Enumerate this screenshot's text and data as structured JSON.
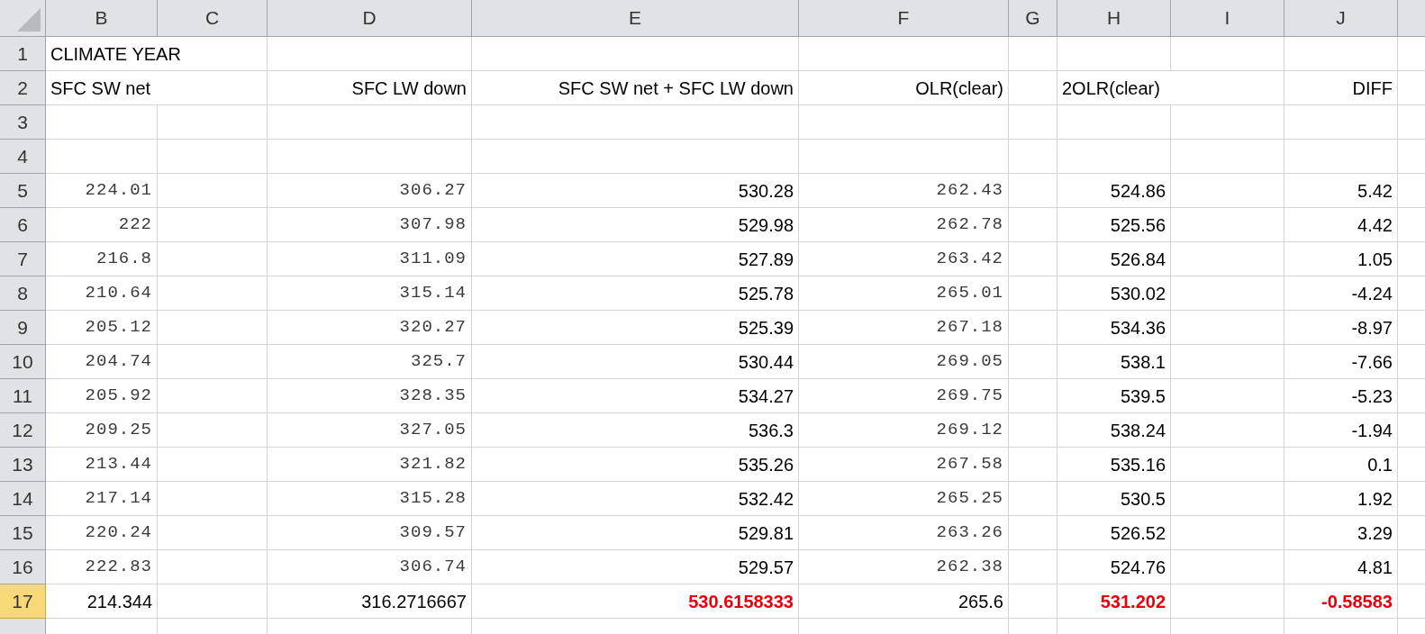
{
  "columns": [
    {
      "label": "B"
    },
    {
      "label": "C"
    },
    {
      "label": "D"
    },
    {
      "label": "E"
    },
    {
      "label": "F"
    },
    {
      "label": "G"
    },
    {
      "label": "H"
    },
    {
      "label": "I"
    },
    {
      "label": "J"
    }
  ],
  "rows": [
    {
      "number": "1",
      "selected": false,
      "cells": {
        "b": {
          "text": "CLIMATE YEAR",
          "kind": "left"
        }
      }
    },
    {
      "number": "2",
      "selected": false,
      "cells": {
        "b": {
          "text": "SFC SW net",
          "kind": "left"
        },
        "d": {
          "text": "SFC LW down",
          "kind": "right"
        },
        "e": {
          "text": "SFC SW net + SFC LW down",
          "kind": "right"
        },
        "f": {
          "text": "OLR(clear)",
          "kind": "right"
        },
        "h": {
          "text": "2OLR(clear)",
          "kind": "left"
        },
        "j": {
          "text": "DIFF",
          "kind": "right"
        }
      }
    },
    {
      "number": "3",
      "selected": false,
      "cells": {}
    },
    {
      "number": "4",
      "selected": false,
      "cells": {}
    },
    {
      "number": "5",
      "selected": false,
      "cells": {
        "b": {
          "text": "224.01",
          "kind": "mono"
        },
        "d": {
          "text": "306.27",
          "kind": "mono"
        },
        "e": {
          "text": "530.28",
          "kind": "right"
        },
        "f": {
          "text": "262.43",
          "kind": "mono"
        },
        "h": {
          "text": "524.86",
          "kind": "right"
        },
        "j": {
          "text": "5.42",
          "kind": "right"
        }
      }
    },
    {
      "number": "6",
      "selected": false,
      "cells": {
        "b": {
          "text": "222",
          "kind": "mono"
        },
        "d": {
          "text": "307.98",
          "kind": "mono"
        },
        "e": {
          "text": "529.98",
          "kind": "right"
        },
        "f": {
          "text": "262.78",
          "kind": "mono"
        },
        "h": {
          "text": "525.56",
          "kind": "right"
        },
        "j": {
          "text": "4.42",
          "kind": "right"
        }
      }
    },
    {
      "number": "7",
      "selected": false,
      "cells": {
        "b": {
          "text": "216.8",
          "kind": "mono"
        },
        "d": {
          "text": "311.09",
          "kind": "mono"
        },
        "e": {
          "text": "527.89",
          "kind": "right"
        },
        "f": {
          "text": "263.42",
          "kind": "mono"
        },
        "h": {
          "text": "526.84",
          "kind": "right"
        },
        "j": {
          "text": "1.05",
          "kind": "right"
        }
      }
    },
    {
      "number": "8",
      "selected": false,
      "cells": {
        "b": {
          "text": "210.64",
          "kind": "mono"
        },
        "d": {
          "text": "315.14",
          "kind": "mono"
        },
        "e": {
          "text": "525.78",
          "kind": "right"
        },
        "f": {
          "text": "265.01",
          "kind": "mono"
        },
        "h": {
          "text": "530.02",
          "kind": "right"
        },
        "j": {
          "text": "-4.24",
          "kind": "right"
        }
      }
    },
    {
      "number": "9",
      "selected": false,
      "cells": {
        "b": {
          "text": "205.12",
          "kind": "mono"
        },
        "d": {
          "text": "320.27",
          "kind": "mono"
        },
        "e": {
          "text": "525.39",
          "kind": "right"
        },
        "f": {
          "text": "267.18",
          "kind": "mono"
        },
        "h": {
          "text": "534.36",
          "kind": "right"
        },
        "j": {
          "text": "-8.97",
          "kind": "right"
        }
      }
    },
    {
      "number": "10",
      "selected": false,
      "cells": {
        "b": {
          "text": "204.74",
          "kind": "mono"
        },
        "d": {
          "text": "325.7",
          "kind": "mono"
        },
        "e": {
          "text": "530.44",
          "kind": "right"
        },
        "f": {
          "text": "269.05",
          "kind": "mono"
        },
        "h": {
          "text": "538.1",
          "kind": "right"
        },
        "j": {
          "text": "-7.66",
          "kind": "right"
        }
      }
    },
    {
      "number": "11",
      "selected": false,
      "cells": {
        "b": {
          "text": "205.92",
          "kind": "mono"
        },
        "d": {
          "text": "328.35",
          "kind": "mono"
        },
        "e": {
          "text": "534.27",
          "kind": "right"
        },
        "f": {
          "text": "269.75",
          "kind": "mono"
        },
        "h": {
          "text": "539.5",
          "kind": "right"
        },
        "j": {
          "text": "-5.23",
          "kind": "right"
        }
      }
    },
    {
      "number": "12",
      "selected": false,
      "cells": {
        "b": {
          "text": "209.25",
          "kind": "mono"
        },
        "d": {
          "text": "327.05",
          "kind": "mono"
        },
        "e": {
          "text": "536.3",
          "kind": "right"
        },
        "f": {
          "text": "269.12",
          "kind": "mono"
        },
        "h": {
          "text": "538.24",
          "kind": "right"
        },
        "j": {
          "text": "-1.94",
          "kind": "right"
        }
      }
    },
    {
      "number": "13",
      "selected": false,
      "cells": {
        "b": {
          "text": "213.44",
          "kind": "mono"
        },
        "d": {
          "text": "321.82",
          "kind": "mono"
        },
        "e": {
          "text": "535.26",
          "kind": "right"
        },
        "f": {
          "text": "267.58",
          "kind": "mono"
        },
        "h": {
          "text": "535.16",
          "kind": "right"
        },
        "j": {
          "text": "0.1",
          "kind": "right"
        }
      }
    },
    {
      "number": "14",
      "selected": false,
      "cells": {
        "b": {
          "text": "217.14",
          "kind": "mono"
        },
        "d": {
          "text": "315.28",
          "kind": "mono"
        },
        "e": {
          "text": "532.42",
          "kind": "right"
        },
        "f": {
          "text": "265.25",
          "kind": "mono"
        },
        "h": {
          "text": "530.5",
          "kind": "right"
        },
        "j": {
          "text": "1.92",
          "kind": "right"
        }
      }
    },
    {
      "number": "15",
      "selected": false,
      "cells": {
        "b": {
          "text": "220.24",
          "kind": "mono"
        },
        "d": {
          "text": "309.57",
          "kind": "mono"
        },
        "e": {
          "text": "529.81",
          "kind": "right"
        },
        "f": {
          "text": "263.26",
          "kind": "mono"
        },
        "h": {
          "text": "526.52",
          "kind": "right"
        },
        "j": {
          "text": "3.29",
          "kind": "right"
        }
      }
    },
    {
      "number": "16",
      "selected": false,
      "cells": {
        "b": {
          "text": "222.83",
          "kind": "mono"
        },
        "d": {
          "text": "306.74",
          "kind": "mono"
        },
        "e": {
          "text": "529.57",
          "kind": "right"
        },
        "f": {
          "text": "262.38",
          "kind": "mono"
        },
        "h": {
          "text": "524.76",
          "kind": "right"
        },
        "j": {
          "text": "4.81",
          "kind": "right"
        }
      }
    },
    {
      "number": "17",
      "selected": true,
      "cells": {
        "b": {
          "text": "214.344",
          "kind": "right",
          "highlight": false
        },
        "d": {
          "text": "316.2716667",
          "kind": "right",
          "highlight": false
        },
        "e": {
          "text": "530.6158333",
          "kind": "right",
          "highlight": true
        },
        "f": {
          "text": "265.6",
          "kind": "right",
          "highlight": false
        },
        "h": {
          "text": "531.202",
          "kind": "right",
          "highlight": true
        },
        "j": {
          "text": "-0.58583",
          "kind": "right",
          "highlight": true
        }
      }
    }
  ]
}
